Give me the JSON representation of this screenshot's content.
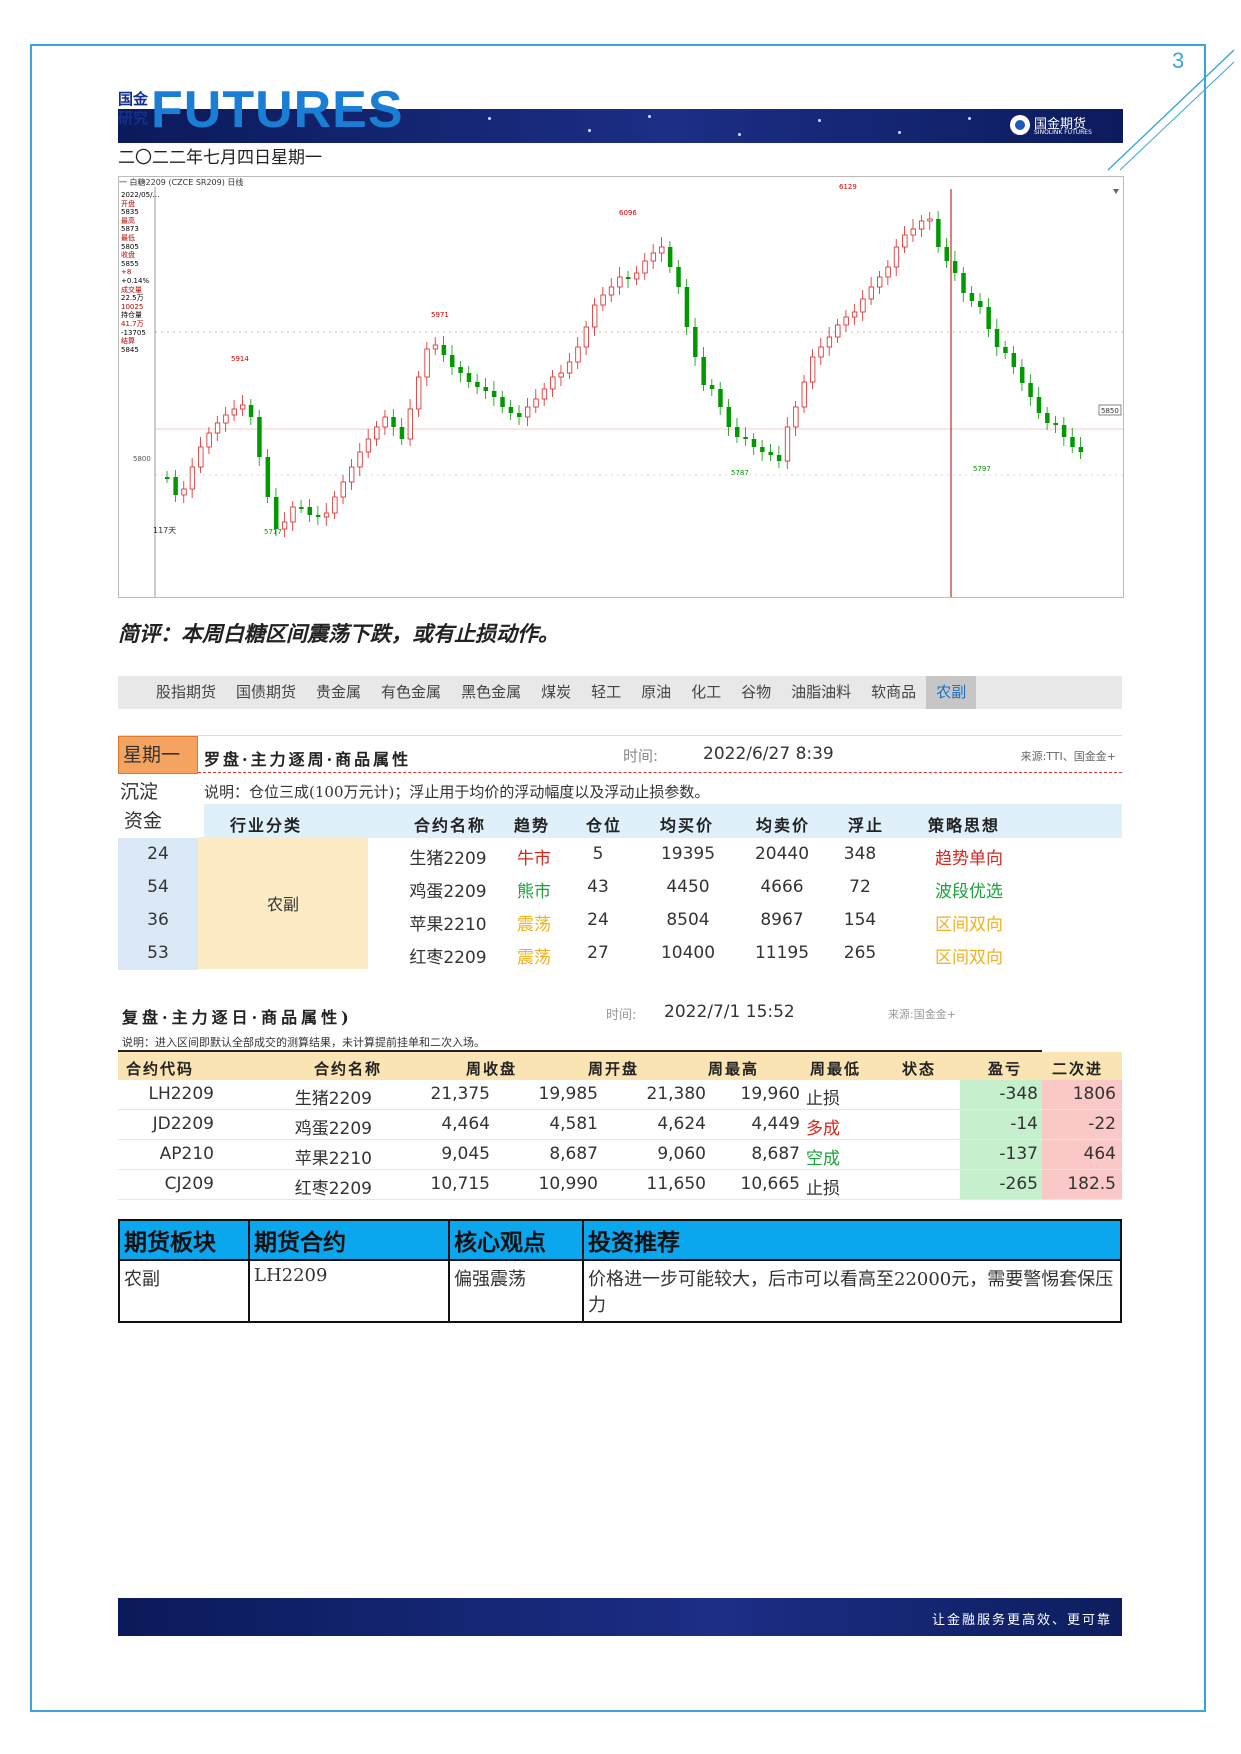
{
  "page": {
    "number": "3"
  },
  "header": {
    "logo_cn_top": "国金",
    "logo_cn_bottom": "研究",
    "logo_futures": "FUTURES",
    "brand": "国金期货",
    "brand_en": "SINOLINK FUTURES",
    "date": "二〇二二年七月四日星期一"
  },
  "chart": {
    "toolbar": "一 白糖2209  (CZCE SR209)  日线",
    "side_labels": [
      "2022/05/…",
      "开盘",
      "5835",
      "最高",
      "5873",
      "最低",
      "5805",
      "收盘",
      "5855",
      "+8",
      "+0.14%",
      "成交量",
      "22.5万",
      "10025",
      "持仓量",
      "41.7万",
      "-13705",
      "结算",
      "5845"
    ],
    "price_markers": {
      "left_level": "5800",
      "right_level": "5850",
      "bottom_count": "117天"
    }
  },
  "chart_data": {
    "type": "candlestick",
    "annotations": [
      {
        "label": "5914",
        "kind": "high"
      },
      {
        "label": "5717",
        "kind": "low"
      },
      {
        "label": "5971",
        "kind": "high"
      },
      {
        "label": "6096",
        "kind": "high"
      },
      {
        "label": "5787",
        "kind": "low"
      },
      {
        "label": "6129",
        "kind": "high"
      },
      {
        "label": "5797",
        "kind": "low"
      }
    ]
  },
  "comment": "简评：本周白糖区间震荡下跌，或有止损动作。",
  "nav": {
    "tabs": [
      "股指期货",
      "国债期货",
      "贵金属",
      "有色金属",
      "黑色金属",
      "煤炭",
      "轻工",
      "原油",
      "化工",
      "谷物",
      "油脂油料",
      "软商品",
      "农副"
    ],
    "active": "农副"
  },
  "table1": {
    "day_label": "星期一",
    "title": "罗盘·主力逐周·商品属性",
    "time_label": "时间:",
    "time_value": "2022/6/27 8:39",
    "source": "来源:TTI、国金金+",
    "left_labels": [
      "沉淀",
      "资金"
    ],
    "note": "说明：仓位三成(100万元计)；浮止用于均价的浮动幅度以及浮动止损参数。",
    "columns": [
      "行业分类",
      "合约名称",
      "趋势",
      "仓位",
      "均买价",
      "均卖价",
      "浮止",
      "策略思想"
    ],
    "sector": "农副",
    "colors": {
      "bull": "#d9261c",
      "bear": "#1aa33a",
      "range": "#f0b21a"
    },
    "rows": [
      {
        "capital": "24",
        "name": "生猪2209",
        "trend": "牛市",
        "trend_color": "#d9261c",
        "pos": "5",
        "buy": "19395",
        "sell": "20440",
        "stop": "348",
        "strategy": "趋势单向",
        "strategy_color": "#d9261c"
      },
      {
        "capital": "54",
        "name": "鸡蛋2209",
        "trend": "熊市",
        "trend_color": "#1aa33a",
        "pos": "43",
        "buy": "4450",
        "sell": "4666",
        "stop": "72",
        "strategy": "波段优选",
        "strategy_color": "#1aa33a"
      },
      {
        "capital": "36",
        "name": "苹果2210",
        "trend": "震荡",
        "trend_color": "#f0b21a",
        "pos": "24",
        "buy": "8504",
        "sell": "8967",
        "stop": "154",
        "strategy": "区间双向",
        "strategy_color": "#f0b21a"
      },
      {
        "capital": "53",
        "name": "红枣2209",
        "trend": "震荡",
        "trend_color": "#f0b21a",
        "pos": "27",
        "buy": "10400",
        "sell": "11195",
        "stop": "265",
        "strategy": "区间双向",
        "strategy_color": "#f0b21a"
      }
    ]
  },
  "table2": {
    "title": "复盘·主力逐日·商品属性)",
    "time_label": "时间:",
    "time_value": "2022/7/1 15:52",
    "source": "来源:国金金+",
    "note": "说明：进入区间即默认全部成交的测算结果，未计算提前挂单和二次入场。",
    "columns": [
      "合约代码",
      "合约名称",
      "周收盘",
      "周开盘",
      "周最高",
      "周最低",
      "状态",
      "盈亏",
      "二次进"
    ],
    "rows": [
      {
        "code": "LH2209",
        "name": "生猪2209",
        "close": "21,375",
        "open": "19,985",
        "high": "21,380",
        "low": "19,960",
        "status": "止损",
        "status_color": "#333333",
        "pnl": "-348",
        "second": "1806"
      },
      {
        "code": "JD2209",
        "name": "鸡蛋2209",
        "close": "4,464",
        "open": "4,581",
        "high": "4,624",
        "low": "4,449",
        "status": "多成",
        "status_color": "#d9261c",
        "pnl": "-14",
        "second": "-22"
      },
      {
        "code": "AP210",
        "name": "苹果2210",
        "close": "9,045",
        "open": "8,687",
        "high": "9,060",
        "low": "8,687",
        "status": "空成",
        "status_color": "#1aa33a",
        "pnl": "-137",
        "second": "464"
      },
      {
        "code": "CJ209",
        "name": "红枣2209",
        "close": "10,715",
        "open": "10,990",
        "high": "11,650",
        "low": "10,665",
        "status": "止损",
        "status_color": "#333333",
        "pnl": "-265",
        "second": "182.5"
      }
    ]
  },
  "table3": {
    "columns": [
      "期货板块",
      "期货合约",
      "核心观点",
      "投资推荐"
    ],
    "row": {
      "sector": "农副",
      "contract": "LH2209",
      "view": "偏强震荡",
      "advice": "价格进一步可能较大，后市可以看高至22000元，需要警惕套保压力"
    }
  },
  "footer": {
    "slogan": "让金融服务更高效、更可靠"
  }
}
